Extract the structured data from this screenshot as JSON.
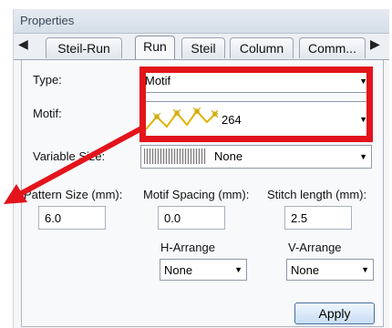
{
  "panel": {
    "title": "Properties",
    "tabs": [
      {
        "label": "Steil-Run",
        "active": false
      },
      {
        "label": "Run",
        "active": true
      },
      {
        "label": "Steil",
        "active": false
      },
      {
        "label": "Column",
        "active": false
      },
      {
        "label": "Comm...",
        "active": false
      }
    ]
  },
  "type_field": {
    "label": "Type:",
    "value": "Motif"
  },
  "motif_field": {
    "label": "Motif:",
    "value": "264"
  },
  "variable_size": {
    "label": "Variable Size:",
    "value": "None"
  },
  "pattern_size": {
    "label": "Pattern Size (mm):",
    "value": "6.0"
  },
  "motif_spacing": {
    "label": "Motif Spacing (mm):",
    "value": "0.0"
  },
  "stitch_length": {
    "label": "Stitch length (mm):",
    "value": "2.5"
  },
  "h_arrange": {
    "label": "H-Arrange",
    "value": "None"
  },
  "v_arrange": {
    "label": "V-Arrange",
    "value": "None"
  },
  "apply_button": {
    "label": "Apply"
  },
  "colors": {
    "highlight": "#e3141b",
    "motif_yellow": "#f2d21b"
  },
  "icons": [
    "tab-scroll-left-icon",
    "tab-scroll-right-icon",
    "dropdown-arrow-icon",
    "motif-pattern-icon",
    "variable-size-pattern-icon",
    "annotation-arrow-icon"
  ]
}
